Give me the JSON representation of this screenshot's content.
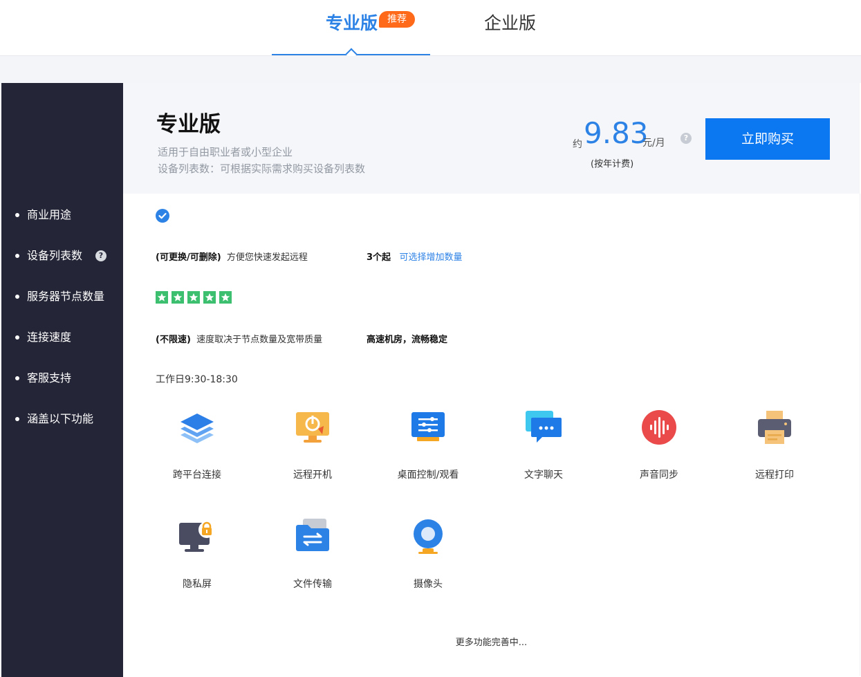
{
  "tabs": {
    "pro_label": "专业版",
    "recommend_badge": "推荐",
    "enterprise_label": "企业版"
  },
  "sidebar": {
    "items": [
      {
        "label": "商业用途"
      },
      {
        "label": "设备列表数"
      },
      {
        "label": "服务器节点数量"
      },
      {
        "label": "连接速度"
      },
      {
        "label": "客服支持"
      },
      {
        "label": "涵盖以下功能"
      }
    ],
    "help_symbol": "?"
  },
  "plan": {
    "title": "专业版",
    "desc_line1": "适用于自由职业者或小型企业",
    "desc_line2": "设备列表数：可根据实际需求购买设备列表数"
  },
  "price": {
    "approx": "约",
    "amount": "9.83",
    "unit": "元/月",
    "note": "(按年计费)",
    "help_symbol": "?",
    "buy_label": "立即购买"
  },
  "rows": {
    "devices_bold": "(可更换/可删除)",
    "devices_text": "方便您快速发起远程",
    "devices_count": "3个起",
    "devices_link": "可选择增加数量",
    "speed_bold": "(不限速)",
    "speed_text": "速度取决于节点数量及宽带质量",
    "speed_highlight": "高速机房，流畅稳定",
    "support_text": "工作日9:30-18:30"
  },
  "server_nodes_stars": 5,
  "features": [
    {
      "label": "跨平台连接",
      "icon": "layers-icon"
    },
    {
      "label": "远程开机",
      "icon": "power-on-icon"
    },
    {
      "label": "桌面控制/观看",
      "icon": "desktop-control-icon"
    },
    {
      "label": "文字聊天",
      "icon": "chat-icon"
    },
    {
      "label": "声音同步",
      "icon": "sound-icon"
    },
    {
      "label": "远程打印",
      "icon": "printer-icon"
    },
    {
      "label": "隐私屏",
      "icon": "privacy-screen-icon"
    },
    {
      "label": "文件传输",
      "icon": "file-transfer-icon"
    },
    {
      "label": "摄像头",
      "icon": "camera-icon"
    }
  ],
  "more_note": "更多功能完善中...",
  "colors": {
    "accent": "#2d82e6",
    "buy_button": "#0b78f2",
    "badge": "#ff6a1a",
    "sidebar_bg": "#242537",
    "star_green": "#3cbf6f"
  }
}
